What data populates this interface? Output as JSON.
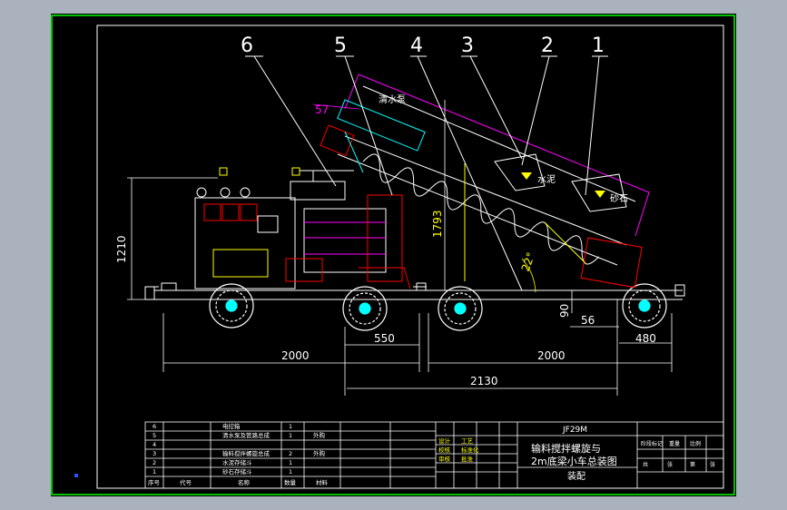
{
  "drawing": {
    "callouts": [
      "6",
      "5",
      "4",
      "3",
      "2",
      "1"
    ],
    "labels": {
      "water_pump": "清水泵",
      "cement": "水泥",
      "sand_stone": "砂石"
    },
    "dimensions": {
      "angle": "22°",
      "d57": "57",
      "d1210": "1210",
      "d1793": "1793",
      "d90": "90",
      "d56": "56",
      "d2000_left": "2000",
      "d550": "550",
      "d2000_right": "2000",
      "d480": "480",
      "d2130": "2130"
    }
  },
  "title_block": {
    "drawing_no": "JF29M",
    "title_line1": "输料搅拌螺旋与",
    "title_line2": "2m底梁小车总装图",
    "subtitle": "装配",
    "parts": [
      {
        "no": "6",
        "name": "电控箱",
        "qty": "1",
        "note": ""
      },
      {
        "no": "5",
        "name": "清水泵及管路总成",
        "qty": "1",
        "note": "外购"
      },
      {
        "no": "4",
        "name": "",
        "qty": "",
        "note": ""
      },
      {
        "no": "3",
        "name": "输料搅拌螺旋总成",
        "qty": "2",
        "note": "外购"
      },
      {
        "no": "2",
        "name": "水泥存储斗",
        "qty": "1",
        "note": ""
      },
      {
        "no": "1",
        "name": "砂石存储斗",
        "qty": "1",
        "note": ""
      }
    ],
    "parts_header": [
      "序号",
      "代号",
      "名称",
      "数量",
      "材料"
    ],
    "approvals": [
      "设计",
      "校核",
      "审核",
      "工艺",
      "标准化",
      "批准"
    ],
    "right_header": [
      "阶段标记",
      "重量",
      "比例"
    ],
    "sheet_info": [
      "共",
      "张",
      "第",
      "张"
    ]
  },
  "colors": {
    "outer_frame": "#a9b2bd",
    "border": "#00ff00",
    "line": "#ffffff",
    "accent_magenta": "#ff00ff",
    "accent_yellow": "#ffff00",
    "accent_cyan": "#00ffff"
  }
}
